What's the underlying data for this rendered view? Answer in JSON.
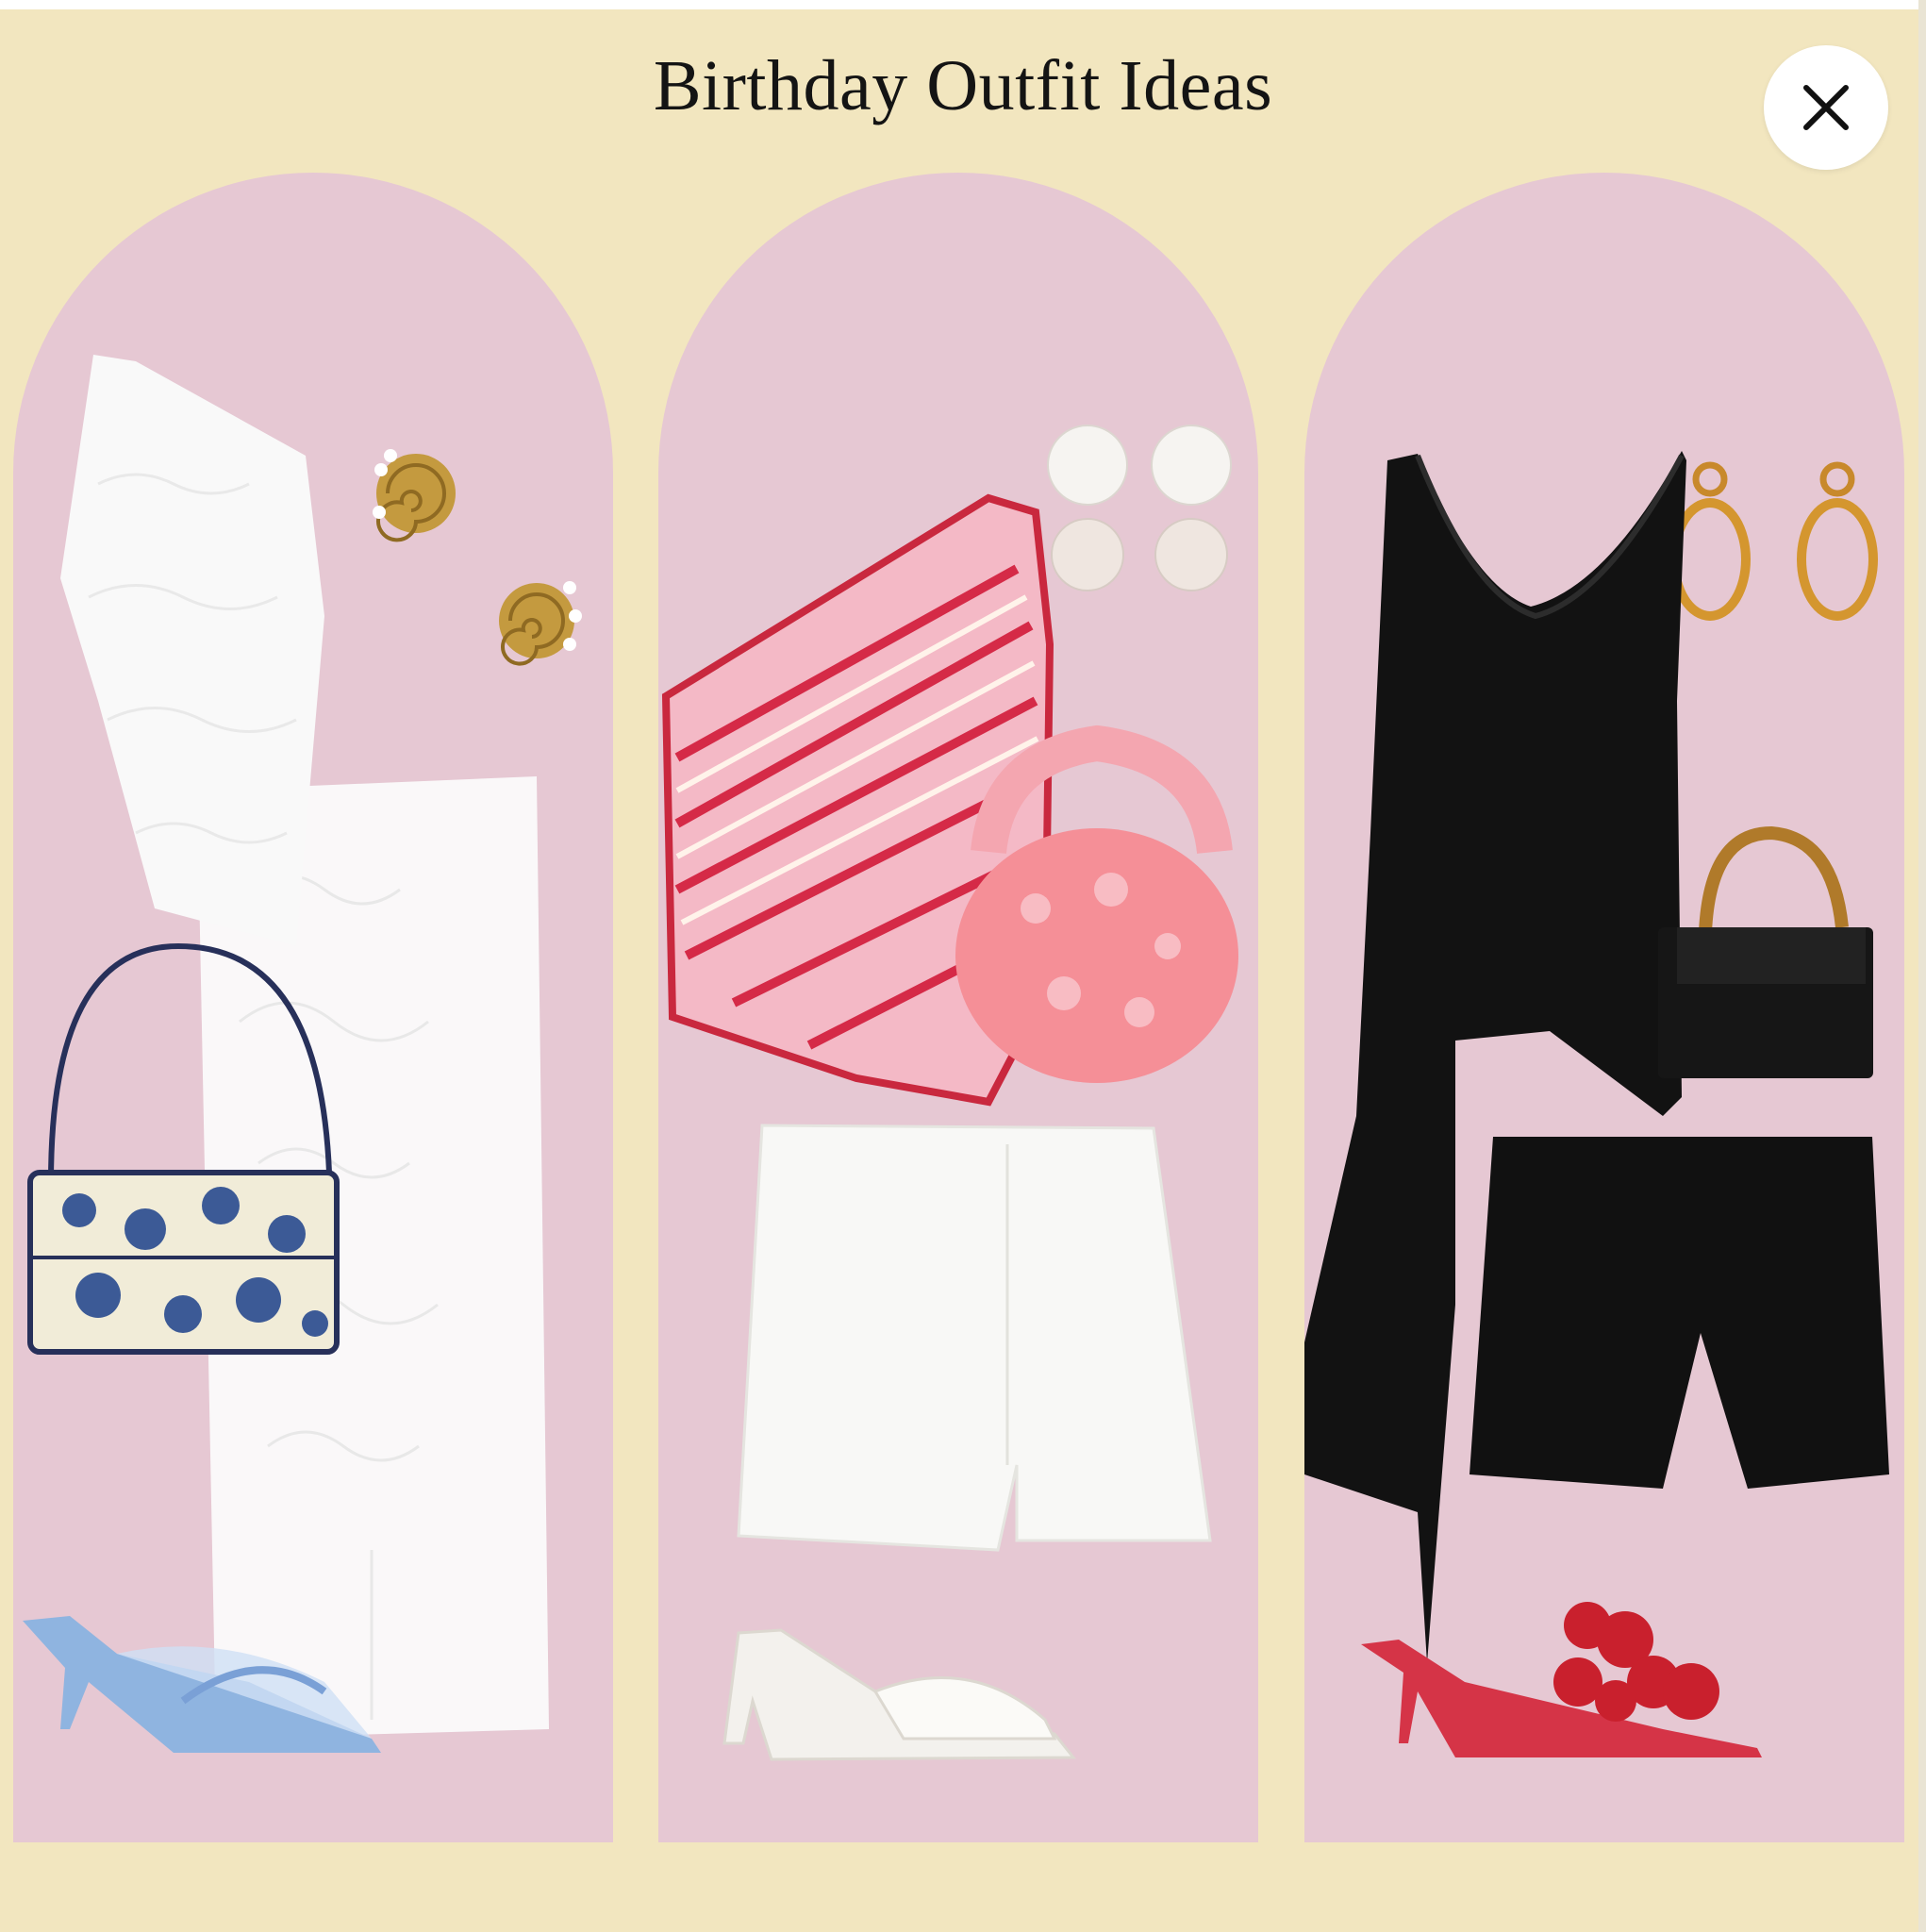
{
  "page": {
    "title": "Birthday Outfit Ideas",
    "background_color": "#f2e6bf",
    "arch_color": "#e6c8d3"
  },
  "close_button": {
    "icon": "close-icon"
  },
  "outfits": [
    {
      "items": [
        "white one-shoulder lace top",
        "gold shell pearl earrings",
        "white lace maxi skirt",
        "blue floral print shoulder bag",
        "blue mesh kitten heel sandals"
      ]
    },
    {
      "items": [
        "pink striped crochet one-shoulder top",
        "white pearl drop earrings",
        "pink beaded mini bag",
        "white mini skirt",
        "white block heel mules"
      ]
    },
    {
      "items": [
        "black asymmetric cowl neck top",
        "gold hoop earrings",
        "black bamboo handle bag",
        "black shorts",
        "red crochet flower kitten heel sandals"
      ]
    }
  ]
}
